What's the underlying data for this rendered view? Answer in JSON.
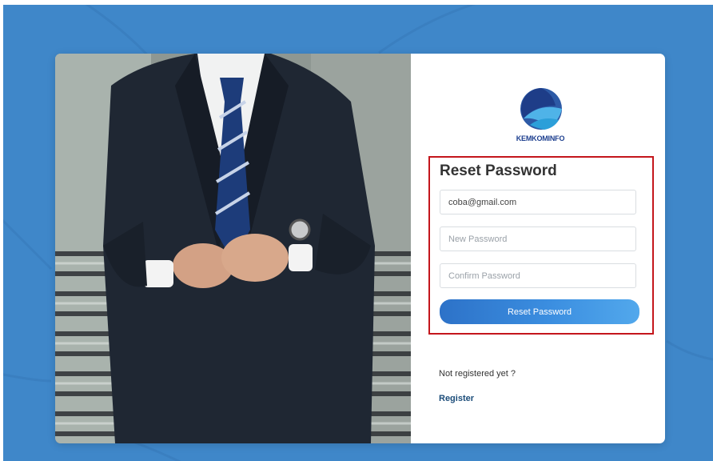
{
  "brand": {
    "logo_text": "KEMKOMINFO"
  },
  "form": {
    "title": "Reset Password",
    "email_value": "coba@gmail.com",
    "new_password_placeholder": "New Password",
    "confirm_password_placeholder": "Confirm Password",
    "submit_label": "Reset Password"
  },
  "footer": {
    "not_registered_text": "Not registered yet ?",
    "register_link": "Register"
  },
  "colors": {
    "background": "#3f87c9",
    "highlight_border": "#c4161c",
    "button": "#3b8ee0",
    "link": "#1c4d7a"
  },
  "icons": {
    "logo": "kemkominfo-logo-icon"
  }
}
